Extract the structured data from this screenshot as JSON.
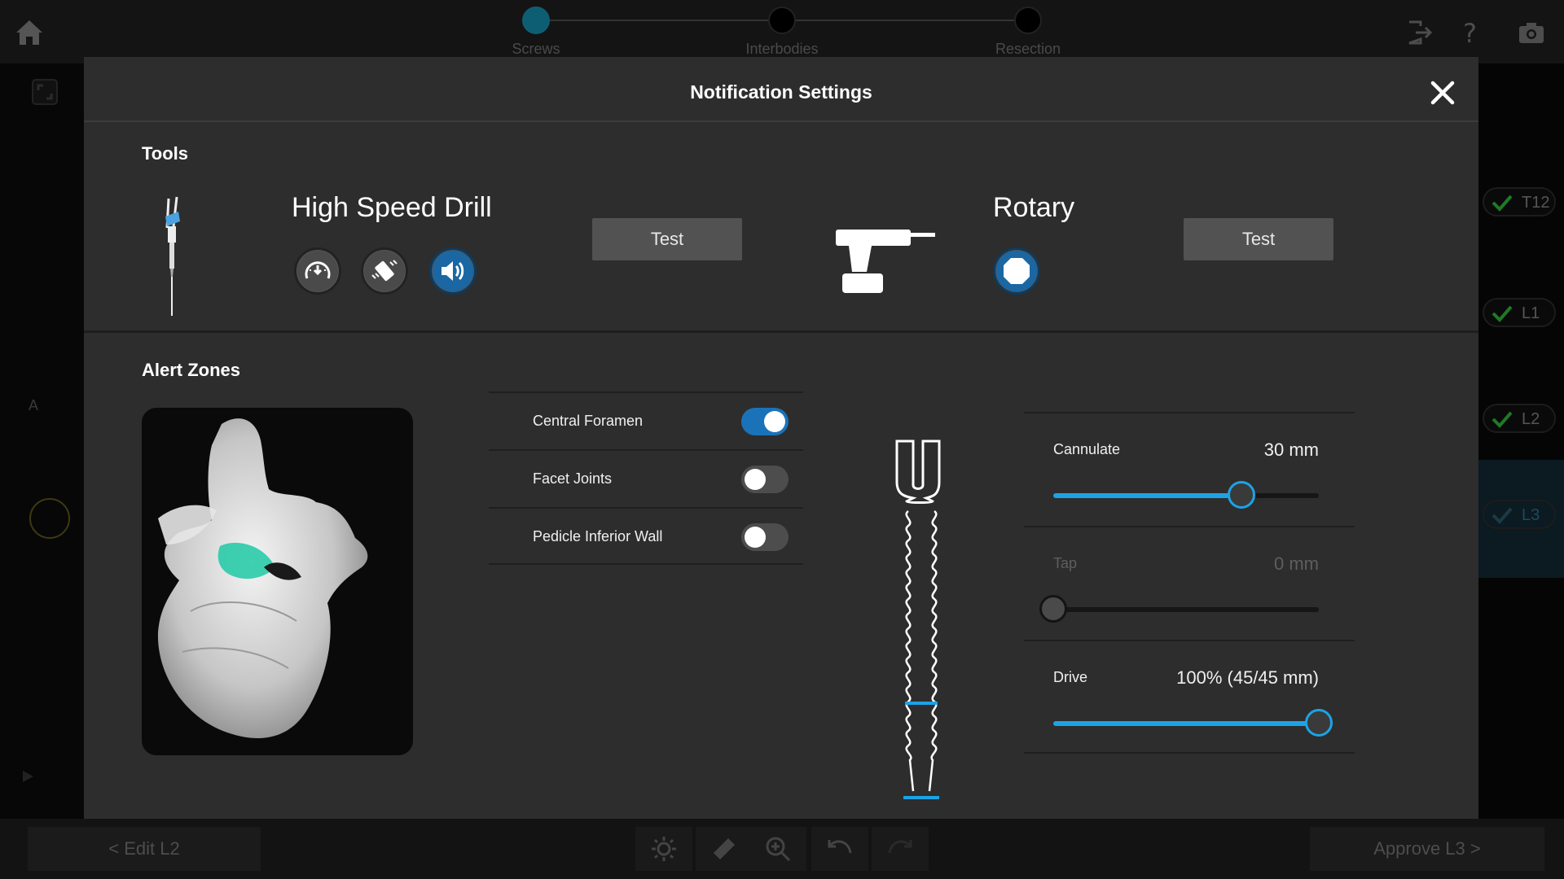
{
  "workflow": {
    "steps": [
      {
        "label": "Screws",
        "active": true
      },
      {
        "label": "Interbodies",
        "active": false
      },
      {
        "label": "Resection",
        "active": false
      }
    ]
  },
  "levels": [
    "T12",
    "L1",
    "L2",
    "L3"
  ],
  "side_marker": "A",
  "bottom": {
    "prev_label": "< Edit L2",
    "next_label": "Approve L3 >"
  },
  "modal": {
    "title": "Notification Settings",
    "tools_title": "Tools",
    "tools": [
      {
        "name": "High Speed Drill",
        "test_label": "Test"
      },
      {
        "name": "Rotary",
        "test_label": "Test"
      }
    ],
    "alert_zones_title": "Alert Zones",
    "zones": [
      {
        "label": "Central Foramen",
        "enabled": true
      },
      {
        "label": "Facet Joints",
        "enabled": false
      },
      {
        "label": "Pedicle Inferior Wall",
        "enabled": false
      }
    ],
    "sliders": [
      {
        "label": "Cannulate",
        "value": "30 mm",
        "fraction": 0.71,
        "enabled": true
      },
      {
        "label": "Tap",
        "value": "0 mm",
        "fraction": 0.0,
        "enabled": false
      },
      {
        "label": "Drive",
        "value": "100% (45/45 mm)",
        "fraction": 1.0,
        "enabled": true
      }
    ]
  },
  "colors": {
    "accent": "#1ca3e6",
    "toggle_on": "#1a73b8",
    "zone_highlight": "#1ec9a6",
    "check": "#2fbf3a"
  }
}
